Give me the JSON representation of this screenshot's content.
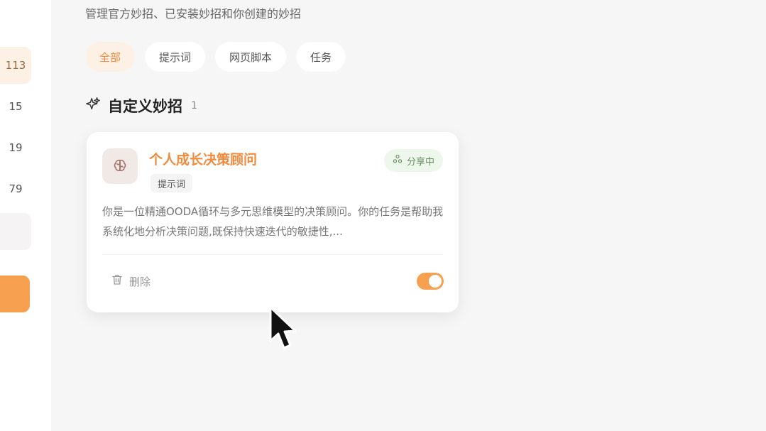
{
  "sidebar": {
    "counts": [
      "113",
      "15",
      "19",
      "79"
    ]
  },
  "header": {
    "subtitle": "管理官方妙招、已安装妙招和你创建的妙招"
  },
  "tabs": [
    {
      "label": "全部",
      "active": true
    },
    {
      "label": "提示词",
      "active": false
    },
    {
      "label": "网页脚本",
      "active": false
    },
    {
      "label": "任务",
      "active": false
    }
  ],
  "section": {
    "title": "自定义妙招",
    "count": "1"
  },
  "card": {
    "title": "个人成长决策顾问",
    "tag": "提示词",
    "share_status": "分享中",
    "description": "你是一位精通OODA循环与多元思维模型的决策顾问。你的任务是帮助我系统化地分析决策问题,既保持快速迭代的敏捷性,...",
    "delete_label": "删除",
    "enabled": true
  },
  "colors": {
    "accent": "#f08a3c",
    "toggle": "#f7a050",
    "share_badge_bg": "#eef7ec"
  }
}
